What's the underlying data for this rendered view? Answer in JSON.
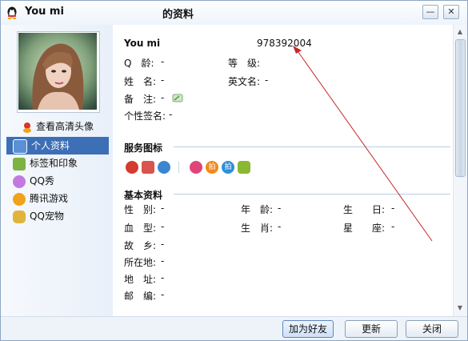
{
  "window": {
    "title_name": "You mi",
    "title_suffix": "的资料",
    "min_glyph": "—",
    "close_glyph": "✕"
  },
  "sidebar": {
    "hd_avatar_label": "查看高清头像",
    "items": [
      {
        "label": "个人资料",
        "icon": "id-card-icon",
        "color": "#5b8fd6"
      },
      {
        "label": "标签和印象",
        "icon": "tag-person-icon",
        "color": "#7cb342"
      },
      {
        "label": "QQ秀",
        "icon": "qqshow-icon",
        "color": "#c27ae0"
      },
      {
        "label": "腾讯游戏",
        "icon": "game-icon",
        "color": "#f0a21b"
      },
      {
        "label": "QQ宠物",
        "icon": "pet-icon",
        "color": "#e0b43c"
      }
    ]
  },
  "profile": {
    "nickname": "You mi",
    "qq_number": "978392004",
    "fields": [
      {
        "label": "Q　龄:",
        "value": "-"
      },
      {
        "label": "等　级:",
        "value": ""
      },
      {
        "label": "姓　名:",
        "value": "-"
      },
      {
        "label": "英文名:",
        "value": "-"
      },
      {
        "label": "备　注:",
        "value": "-"
      },
      {
        "label": "个性签名:",
        "value": "-"
      }
    ]
  },
  "services": {
    "title": "服务图标",
    "icons": [
      {
        "name": "qq-penguin-icon",
        "color": "#d23b2e",
        "glyph": ""
      },
      {
        "name": "mail-icon",
        "color": "#d9534f",
        "glyph": ""
      },
      {
        "name": "chat-bubble-icon",
        "color": "#3a86d1",
        "glyph": ""
      },
      {
        "name": "heart-love-icon",
        "color": "#e0447a",
        "glyph": ""
      },
      {
        "name": "paipai-orange-icon",
        "color": "#f08a1c",
        "glyph": "拍"
      },
      {
        "name": "paipai-blue-icon",
        "color": "#2f8fd8",
        "glyph": "拍"
      },
      {
        "name": "stack-coins-icon",
        "color": "#8ab832",
        "glyph": ""
      }
    ]
  },
  "basic": {
    "title": "基本资料",
    "fields": [
      {
        "label": "性　别:",
        "value": "-"
      },
      {
        "label": "年　龄:",
        "value": "-"
      },
      {
        "label": "生　　日:",
        "value": "-"
      },
      {
        "label": "血　型:",
        "value": "-"
      },
      {
        "label": "生　肖:",
        "value": "-"
      },
      {
        "label": "星　　座:",
        "value": "-"
      },
      {
        "label": "故　乡:",
        "value": "-"
      },
      {
        "label": "所在地:",
        "value": "-"
      },
      {
        "label": "地　址:",
        "value": "-"
      },
      {
        "label": "邮　编:",
        "value": "-"
      }
    ]
  },
  "footer": {
    "add_friend": "加为好友",
    "update": "更新",
    "close": "关闭"
  },
  "colors": {
    "accent": "#3d6fb6",
    "annotation_arrow": "#c62828"
  }
}
